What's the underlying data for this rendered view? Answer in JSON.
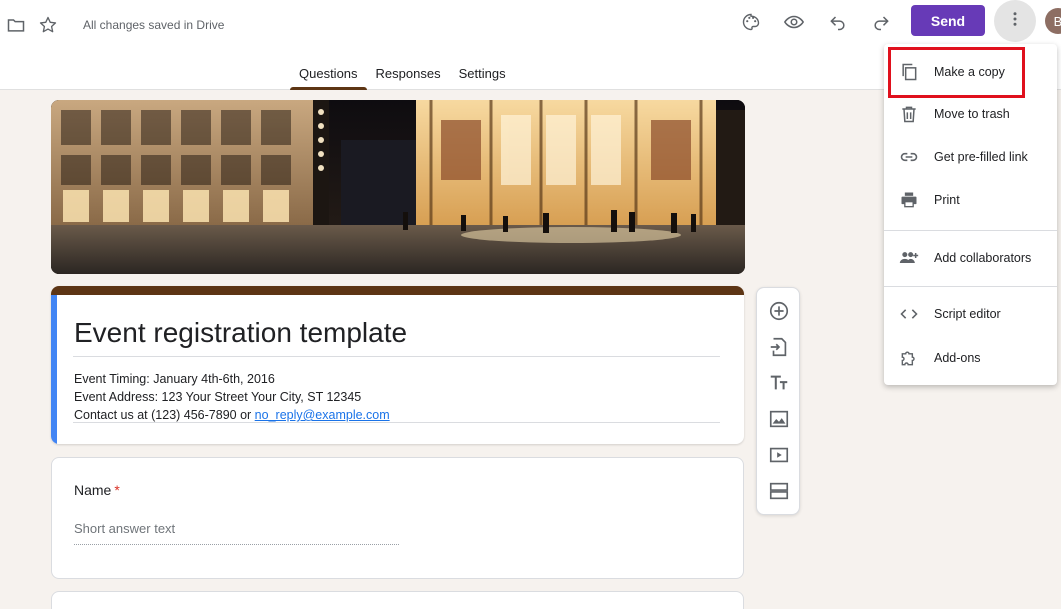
{
  "topbar": {
    "save_status": "All changes saved in Drive",
    "send_label": "Send",
    "avatar_initial": "B",
    "icons": [
      "folder-icon",
      "star-icon",
      "palette-icon",
      "eye-icon",
      "undo-icon",
      "redo-icon",
      "more-vert-icon"
    ]
  },
  "tabs": [
    {
      "label": "Questions",
      "active": true
    },
    {
      "label": "Responses",
      "active": false
    },
    {
      "label": "Settings",
      "active": false
    }
  ],
  "form": {
    "title": "Event registration template",
    "description": {
      "timing": "Event Timing: January 4th-6th, 2016",
      "address": "Event Address: 123 Your Street Your City, ST 12345",
      "contact_prefix": "Contact us at (123) 456-7890 or ",
      "contact_email": "no_reply@example.com"
    },
    "questions": [
      {
        "label": "Name",
        "required_mark": "*",
        "placeholder": "Short answer text"
      }
    ]
  },
  "side_toolbar": [
    "add-question-icon",
    "import-questions-icon",
    "add-title-icon",
    "add-image-icon",
    "add-video-icon",
    "add-section-icon"
  ],
  "menu": {
    "items": [
      {
        "label": "Make a copy",
        "icon": "copy-icon",
        "highlighted": true
      },
      {
        "label": "Move to trash",
        "icon": "trash-icon"
      },
      {
        "label": "Get pre-filled link",
        "icon": "link-icon"
      },
      {
        "label": "Print",
        "icon": "print-icon"
      },
      {
        "label": "Add collaborators",
        "icon": "add-people-icon"
      },
      {
        "label": "Script editor",
        "icon": "code-icon"
      },
      {
        "label": "Add-ons",
        "icon": "puzzle-icon"
      }
    ]
  },
  "colors": {
    "accent": "#673ab7",
    "theme": "#5d3514",
    "title_band": "#4285f4",
    "highlight": "#e0101d",
    "background": "#f6f2ee"
  }
}
